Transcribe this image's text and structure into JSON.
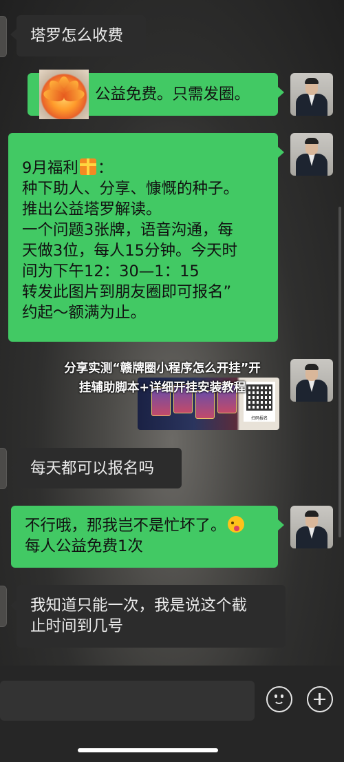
{
  "messages": [
    {
      "side": "left",
      "lines": [
        "塔罗怎么收费"
      ]
    },
    {
      "side": "right",
      "lines": [
        "公益免费。只需发圈。"
      ]
    },
    {
      "side": "right",
      "lines": [
        "9月福利",
        "：",
        "种下助人、分享、慷慨的种子。",
        "推出公益塔罗解读。",
        "一个问题3张牌，语音沟通，每",
        "天做3位，每人15分钟。今天时",
        "间为下午12：30—1：15",
        "转发此图片到朋友圈即可报名”",
        "约起～额满为止。"
      ]
    },
    {
      "side": "left",
      "lines": [
        "每天都可以报名吗"
      ]
    },
    {
      "side": "right",
      "lines": [
        "不行哦，那我岂不是忙坏了。",
        "每人公益免费1次"
      ]
    },
    {
      "side": "left",
      "lines": [
        "我知道只能一次，我是说这个截",
        "止时间到几号"
      ]
    }
  ],
  "overlay": {
    "line1": "分享实测“赣牌圈小程序怎么开挂”开",
    "line2": "挂辅助脚本+详细开挂安装教程"
  },
  "thumbnail": {
    "qr_label": "扫码报名"
  },
  "icons": {
    "emoji_button": "smiley-icon",
    "more_button": "plus-icon"
  },
  "colors": {
    "green_bubble": "#42c964",
    "dark_bubble": "#2c2c2c"
  }
}
